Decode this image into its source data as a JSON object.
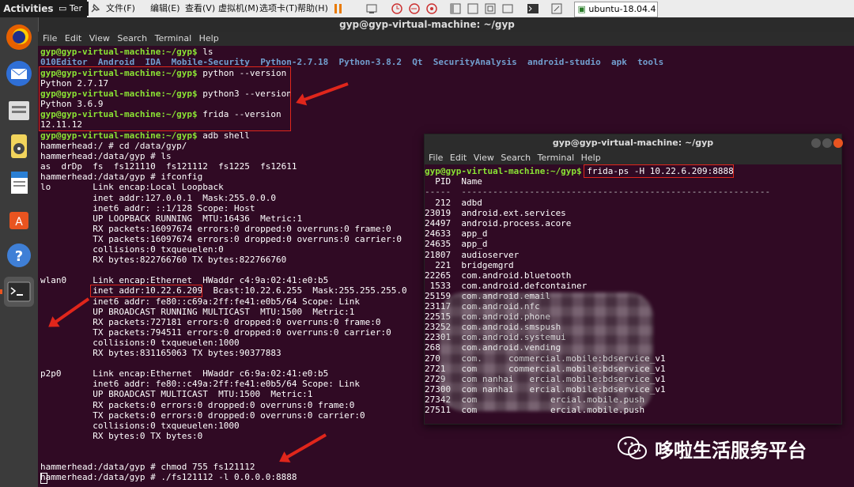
{
  "vmware": {
    "activities": "Activities",
    "terminal_tab_stub": "Ter",
    "menus": [
      "文件(F)",
      "编辑(E)",
      "查看(V)",
      "虚拟机(M)",
      "选项卡(T)",
      "帮助(H)"
    ],
    "vm_tab": "ubuntu-18.04.4"
  },
  "main_window": {
    "title": "gyp@gyp-virtual-machine: ~/gyp",
    "menu": [
      "File",
      "Edit",
      "View",
      "Search",
      "Terminal",
      "Help"
    ],
    "prompt": "gyp@gyp-virtual-machine:~/gyp$",
    "ls_cmd": " ls",
    "ls_output": [
      "010Editor",
      "Android",
      "IDA",
      "Mobile-Security",
      "Python-2.7.18",
      "Python-3.8.2",
      "Qt",
      "SecurityAnalysis",
      "android-studio",
      "apk",
      "tools"
    ],
    "cmd_python": " python --version",
    "out_python": "Python 2.7.17",
    "cmd_python3": " python3 --version",
    "out_python3": "Python 3.6.9",
    "cmd_frida": " frida --version",
    "out_frida": "12.11.12",
    "cmd_adb": " adb shell",
    "shell_lines": [
      "hammerhead:/ # cd /data/gyp/",
      "hammerhead:/data/gyp # ls",
      "as  drDp  fs  fs121110  fs121112  fs1225  fs12611",
      "hammerhead:/data/gyp # ifconfig",
      "lo        Link encap:Local Loopback",
      "          inet addr:127.0.0.1  Mask:255.0.0.0",
      "          inet6 addr: ::1/128 Scope: Host",
      "          UP LOOPBACK RUNNING  MTU:16436  Metric:1",
      "          RX packets:16097674 errors:0 dropped:0 overruns:0 frame:0",
      "          TX packets:16097674 errors:0 dropped:0 overruns:0 carrier:0",
      "          collisions:0 txqueuelen:0",
      "          RX bytes:822766760 TX bytes:822766760",
      "",
      "wlan0     Link encap:Ethernet  HWaddr c4:9a:02:41:e0:b5",
      "          inet addr:10.22.6.209  Bcast:10.22.6.255  Mask:255.255.255.0",
      "          inet6 addr: fe80::c69a:2ff:fe41:e0b5/64 Scope: Link",
      "          UP BROADCAST RUNNING MULTICAST  MTU:1500  Metric:1",
      "          RX packets:727181 errors:0 dropped:0 overruns:0 frame:0",
      "          TX packets:794511 errors:0 dropped:0 overruns:0 carrier:0",
      "          collisions:0 txqueuelen:1000",
      "          RX bytes:831165063 TX bytes:90377883",
      "",
      "p2p0      Link encap:Ethernet  HWaddr c6:9a:02:41:e0:b5",
      "          inet6 addr: fe80::c49a:2ff:fe41:e0b5/64 Scope: Link",
      "          UP BROADCAST MULTICAST  MTU:1500  Metric:1",
      "          RX packets:0 errors:0 dropped:0 overruns:0 frame:0",
      "          TX packets:0 errors:0 dropped:0 overruns:0 carrier:0",
      "          collisions:0 txqueuelen:1000",
      "          RX bytes:0 TX bytes:0",
      "",
      "",
      "hammerhead:/data/gyp # chmod 755 fs121112",
      "hammerhead:/data/gyp # ./fs121112 -l 0.0.0.0:8888"
    ]
  },
  "second_window": {
    "title": "gyp@gyp-virtual-machine: ~/gyp",
    "menu": [
      "File",
      "Edit",
      "View",
      "Search",
      "Terminal",
      "Help"
    ],
    "prompt": "gyp@gyp-virtual-machine:~/gyp$",
    "command": "frida-ps -H 10.22.6.209:8888",
    "header": "  PID  Name",
    "separator": "-----  -----------------------------------------------------------",
    "rows": [
      "  212  adbd",
      "23019  android.ext.services",
      "24497  android.process.acore",
      "24633  app_d",
      "24635  app_d",
      "21807  audioserver",
      "  221  bridgemgrd",
      "22265  com.android.bluetooth",
      " 1533  com.android.defcontainer",
      "25159  com.android.email",
      "23117  com.android.nfc",
      "22515  com.android.phone",
      "23252  com.android.smspush",
      "22301  com.android.systemui",
      "268    com.android.vending",
      "270    com.     commercial.mobile:bdservice_v1",
      "2721   com      commercial.mobile:bdservice_v1",
      "2729   com nanhai   ercial.mobile:bdservice_v1",
      "27300  com nanhai   ercial.mobile:bdservice_v1",
      "27342  com              ercial.mobile.push",
      "27511  com              ercial.mobile.push"
    ]
  },
  "watermark": "哆啦生活服务平台",
  "colors": {
    "accent_red": "#e0261b",
    "prompt_green": "#8ae234",
    "dir_blue": "#6ba8ff",
    "terminal_bg": "#300a24"
  }
}
